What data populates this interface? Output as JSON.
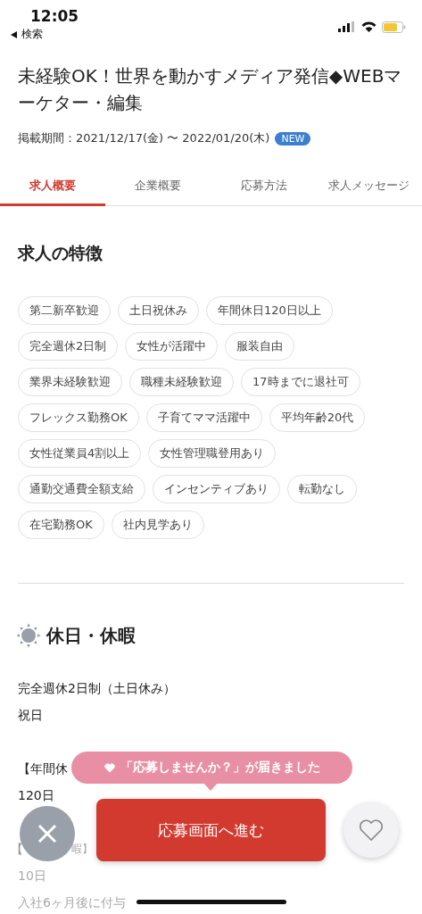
{
  "status_bar": {
    "time": "12:05",
    "back_label": "検索"
  },
  "title": "未経験OK！世界を動かすメディア発信◆WEBマーケター・編集",
  "period": {
    "text": "掲載期間：2021/12/17(金) 〜 2022/01/20(木)",
    "badge": "NEW"
  },
  "tabs": [
    {
      "label": "求人概要",
      "selected": true
    },
    {
      "label": "企業概要",
      "selected": false
    },
    {
      "label": "応募方法",
      "selected": false
    },
    {
      "label": "求人メッセージ",
      "selected": false
    }
  ],
  "features": {
    "heading": "求人の特徴",
    "tags": [
      "第二新卒歓迎",
      "土日祝休み",
      "年間休日120日以上",
      "完全週休2日制",
      "女性が活躍中",
      "服装自由",
      "業界未経験歓迎",
      "職種未経験歓迎",
      "17時までに退社可",
      "フレックス勤務OK",
      "子育てママ活躍中",
      "平均年齢20代",
      "女性従業員4割以上",
      "女性管理職登用あり",
      "通勤交通費全額支給",
      "インセンティブあり",
      "転勤なし",
      "在宅勤務OK",
      "社内見学あり"
    ]
  },
  "holidays": {
    "heading": "休日・休暇",
    "lines": [
      {
        "kind": "text",
        "text": "完全週休2日制（土日休み）"
      },
      {
        "kind": "text",
        "text": "祝日"
      },
      {
        "kind": "gap"
      },
      {
        "kind": "text",
        "text": "【年間休"
      },
      {
        "kind": "text",
        "text": "120日"
      },
      {
        "kind": "gap"
      },
      {
        "kind": "split",
        "left": "【",
        "right": "暇】"
      },
      {
        "kind": "faded",
        "text": "10日"
      },
      {
        "kind": "faded",
        "text": "入社6ヶ月後に付与"
      }
    ]
  },
  "notice": "「応募しませんか？」が届きました",
  "apply_button": "応募画面へ進む"
}
